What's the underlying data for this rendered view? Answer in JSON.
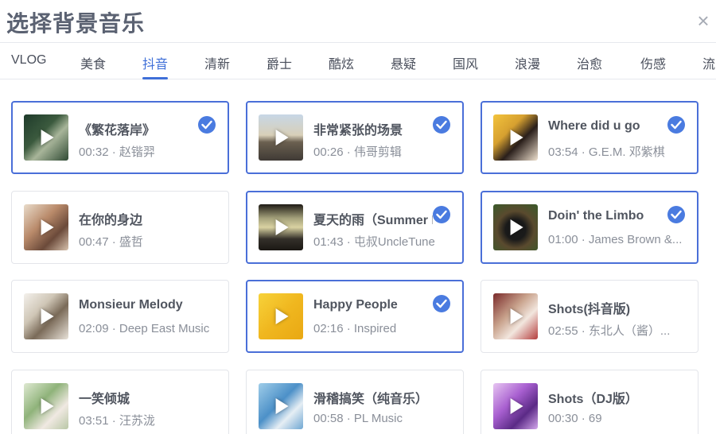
{
  "dialog": {
    "title": "选择背景音乐",
    "close_glyph": "×"
  },
  "tabs": [
    "VLOG",
    "美食",
    "抖音",
    "清新",
    "爵士",
    "酷炫",
    "悬疑",
    "国风",
    "浪漫",
    "治愈",
    "伤感",
    "流"
  ],
  "active_tab": "抖音",
  "accent_color": "#4a6fd8",
  "tracks": [
    {
      "name": "《繁花落岸》",
      "meta": "00:32 · 赵锴羿",
      "selected": true,
      "thumb_icon": "album-cover"
    },
    {
      "name": "非常紧张的场景",
      "meta": "00:26 · 伟哥剪辑",
      "selected": true,
      "thumb_icon": "album-cover"
    },
    {
      "name": "Where did u go",
      "meta": "03:54 · G.E.M. 邓紫棋",
      "selected": true,
      "thumb_icon": "album-cover"
    },
    {
      "name": "在你的身边",
      "meta": "00:47 · 盛哲",
      "selected": false,
      "thumb_icon": "album-cover"
    },
    {
      "name": "夏天的雨（Summer I",
      "meta": "01:43 · 屯叔UncleTune",
      "selected": true,
      "thumb_icon": "album-cover"
    },
    {
      "name": "Doin' the Limbo",
      "meta": "01:00 · James Brown &...",
      "selected": true,
      "thumb_icon": "album-cover"
    },
    {
      "name": "Monsieur Melody",
      "meta": "02:09 · Deep East Music",
      "selected": false,
      "thumb_icon": "album-cover"
    },
    {
      "name": "Happy People",
      "meta": "02:16 · Inspired",
      "selected": true,
      "thumb_icon": "album-cover"
    },
    {
      "name": "Shots(抖音版)",
      "meta": "02:55 · 东北人（酱）...",
      "selected": false,
      "thumb_icon": "album-cover"
    },
    {
      "name": "一笑倾城",
      "meta": "03:51 · 汪苏泷",
      "selected": false,
      "thumb_icon": "album-cover"
    },
    {
      "name": "滑稽搞笑（纯音乐）",
      "meta": "00:58 · PL Music",
      "selected": false,
      "thumb_icon": "album-cover"
    },
    {
      "name": "Shots（DJ版）",
      "meta": "00:30 · 69",
      "selected": false,
      "thumb_icon": "album-cover"
    }
  ]
}
